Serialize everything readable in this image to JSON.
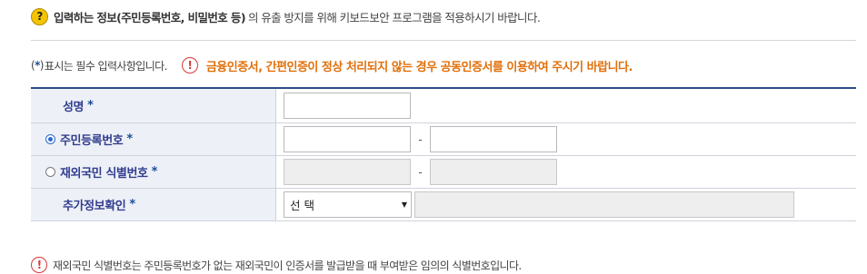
{
  "top_notice": {
    "bold_text": "입력하는 정보(주민등록번호, 비밀번호 등)",
    "text": "의 유출 방지를 위해 키보드보안 프로그램을 적용하시기 바랍니다."
  },
  "required_notice": {
    "open": "(",
    "star": "*",
    "close": ")",
    "text": "표시는 필수 입력사항입니다.",
    "warning": "금융인증서, 간편인증이 정상 처리되지 않는 경우 공동인증서를 이용하여 주시기 바랍니다."
  },
  "form": {
    "star": "*",
    "name_label": "성명",
    "resident_label": "주민등록번호",
    "foreign_label": "재외국민 식별번호",
    "extra_label": "추가정보확인",
    "dash": "-",
    "select_value": "선 택",
    "resident_selected": true
  },
  "bottom_notice": {
    "text": "재외국민 식별번호는 주민등록번호가 없는 재외국민이 인증서를 발급받을 때 부여받은 임의의 식별번호입니다."
  },
  "icons": {
    "question": "?",
    "warning": "!"
  },
  "colors": {
    "label_text": "#333d8f",
    "label_bg": "#edf1f7",
    "warning_orange": "#e1700c",
    "warning_red": "#d9383a",
    "table_top_border": "#2c4e86",
    "question_yellow": "#f4c400"
  }
}
